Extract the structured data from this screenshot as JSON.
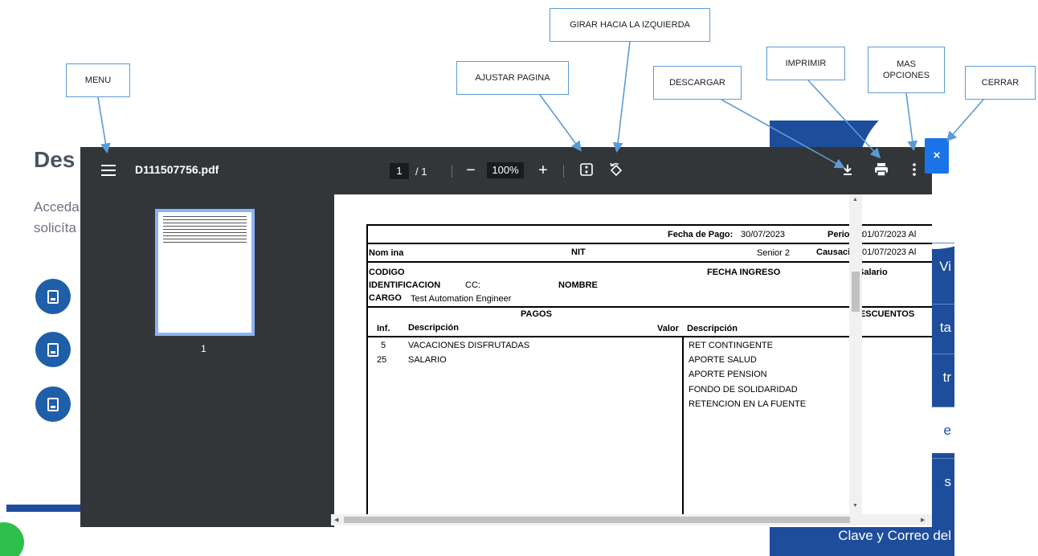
{
  "background": {
    "title": "Des",
    "line1": "Acceda",
    "line2": "solicíta",
    "panel_items": [
      "Vi",
      "ta",
      "tr",
      "e",
      "s"
    ],
    "panel_bottom": "Clave y Correo del"
  },
  "viewer": {
    "menu_icon": "hamburger-menu-icon",
    "filename": "D111507756.pdf",
    "page_current": "1",
    "page_total": "/  1",
    "zoom_out": "−",
    "zoom_value": "100%",
    "zoom_in": "+",
    "fit_icon": "fit-page-icon",
    "rotate_icon": "rotate-left-icon",
    "download_icon": "download-icon",
    "print_icon": "print-icon",
    "more_icon": "more-vert-icon",
    "close_label": "×",
    "thumbnail_number": "1"
  },
  "document": {
    "fecha_pago_label": "Fecha de Pago:",
    "fecha_pago_value": "30/07/2023",
    "periodo_label": "Periodo:",
    "periodo_value": "01/07/2023 Al",
    "nomina_label": "Nom ina",
    "nit_label": "NIT",
    "senior": "Senior 2",
    "causacion_label": "Causación",
    "causacion_value": "01/07/2023 Al",
    "codigo_label": "CODIGO",
    "fecha_ingreso_label": "FECHA INGRESO",
    "salario_label": "Salario",
    "identificacion_label": "IDENTIFICACION",
    "cc_label": "CC:",
    "nombre_label": "NOMBRE",
    "cargo_label": "CARGO",
    "cargo_value": "Test Automation Engineer",
    "pagos_label": "PAGOS",
    "descuentos_label": "DESCUENTOS",
    "inf_header": "Inf.",
    "descripcion_header": "Descripción",
    "valor_header": "Valor",
    "descripcion_header_2": "Descripción",
    "pagos_rows": [
      {
        "inf": "5",
        "desc": "VACACIONES DISFRUTADAS"
      },
      {
        "inf": "25",
        "desc": "SALARIO"
      }
    ],
    "descuentos_rows": [
      "RET CONTINGENTE",
      "APORTE SALUD",
      "APORTE PENSION",
      "FONDO DE SOLIDARIDAD",
      "RETENCION EN LA FUENTE"
    ]
  },
  "annotations": {
    "menu": "MENU",
    "ajustar": "AJUSTAR PAGINA",
    "girar": "GIRAR HACIA LA IZQUIERDA",
    "descargar": "DESCARGAR",
    "imprimir": "IMPRIMIR",
    "mas_opciones": "MAS OPCIONES",
    "cerrar": "CERRAR"
  },
  "colors": {
    "toolbar": "#323639",
    "annotation_border": "#5b9bd5",
    "close_button": "#1a73e8",
    "panel_blue": "#1d4d9b"
  }
}
